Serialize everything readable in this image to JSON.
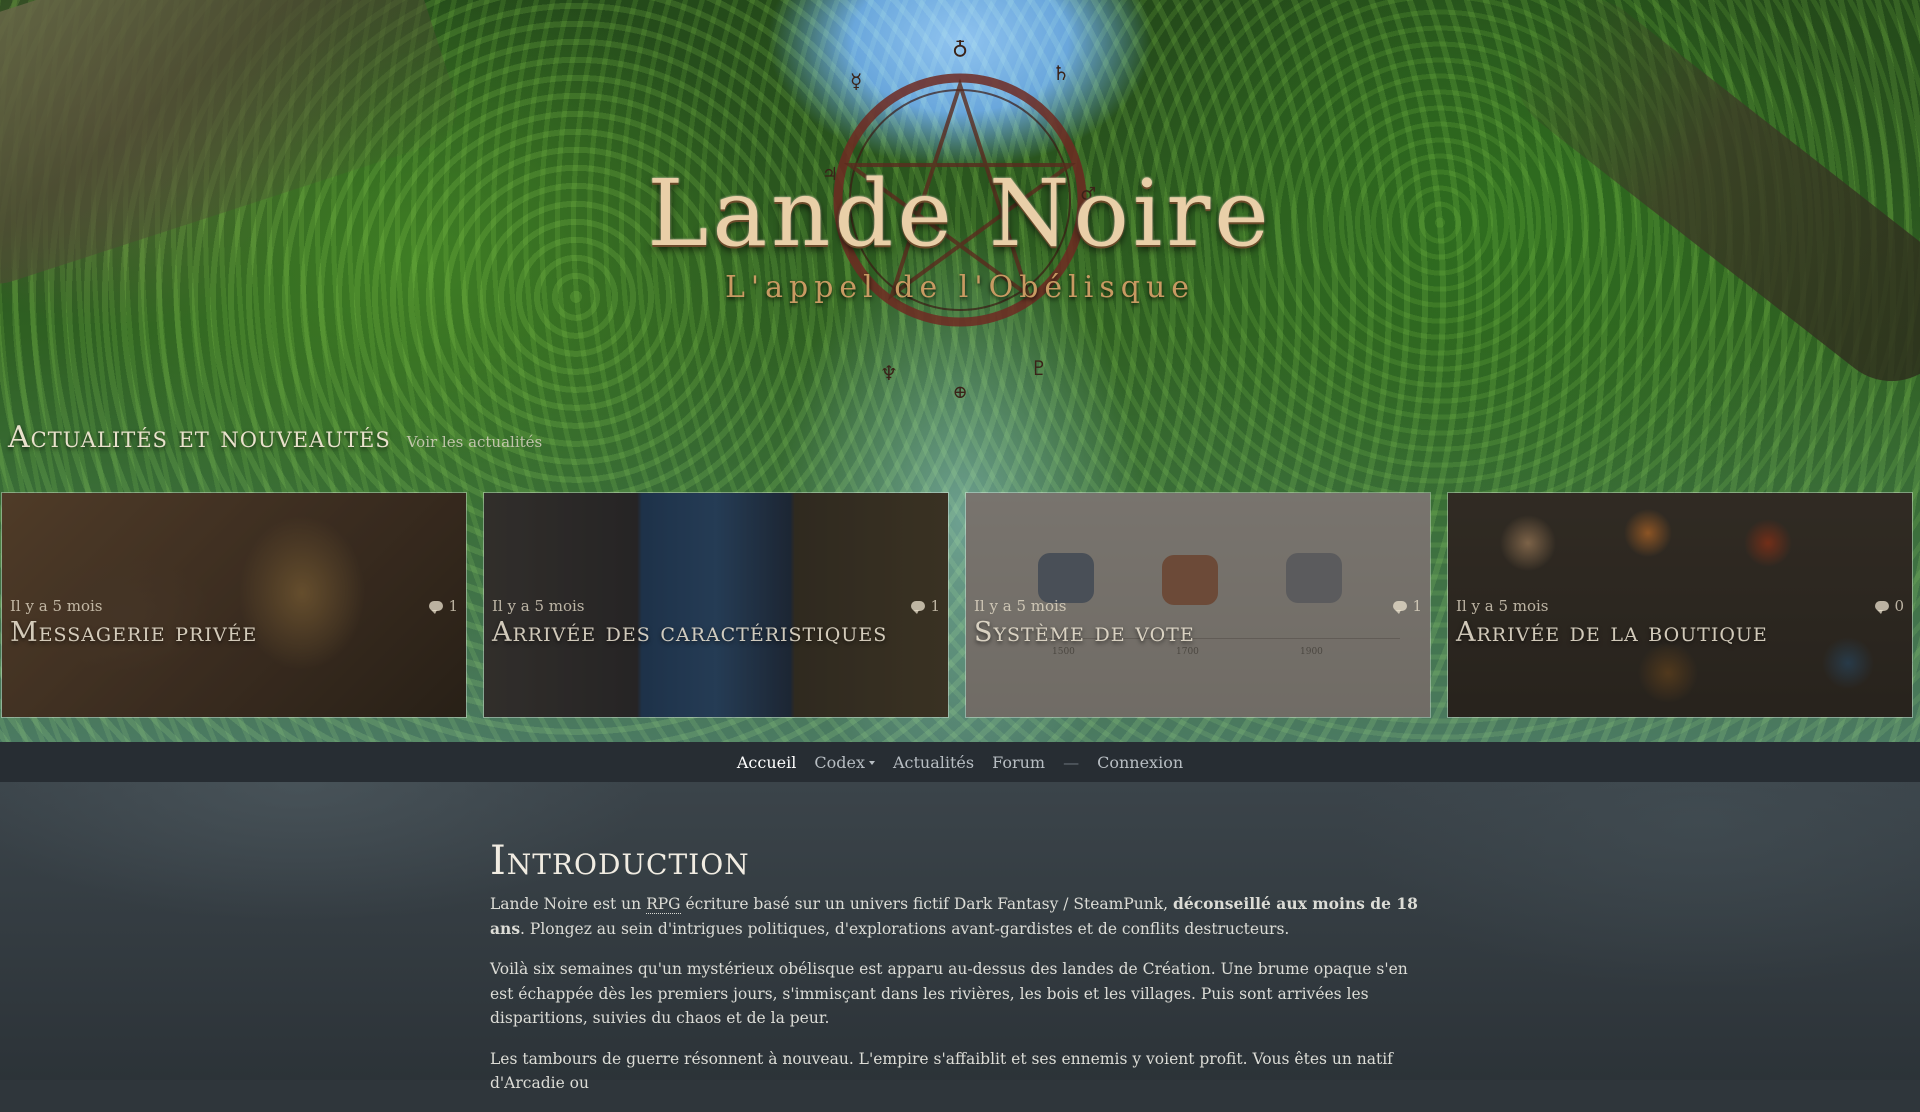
{
  "hero": {
    "logo_title": "Lande Noire",
    "logo_subtitle": "L'appel de l'Obélisque"
  },
  "news": {
    "title": "Actualités et nouveautés",
    "link": "Voir les actualités",
    "cards": [
      {
        "time": "Il y a 5 mois",
        "comments": "1",
        "title": "Messagerie privée"
      },
      {
        "time": "Il y a 5 mois",
        "comments": "1",
        "title": "Arrivée des caractéristiques"
      },
      {
        "time": "Il y a 5 mois",
        "comments": "1",
        "title": "Système de vote",
        "chart_labels": [
          "1500",
          "1700",
          "1900"
        ]
      },
      {
        "time": "Il y a 5 mois",
        "comments": "0",
        "title": "Arrivée de la boutique"
      }
    ]
  },
  "nav": {
    "items": [
      "Accueil",
      "Codex",
      "Actualités",
      "Forum"
    ],
    "separator": "—",
    "login": "Connexion"
  },
  "intro": {
    "heading": "Introduction",
    "p1_before": "Lande Noire est un ",
    "p1_abbr": "RPG",
    "p1_middle": " écriture basé sur un univers fictif Dark Fantasy / SteamPunk, ",
    "p1_bold": "déconseillé aux moins de 18 ans",
    "p1_after": ". Plongez au sein d'intrigues politiques, d'explorations avant-gardistes et de conflits destructeurs.",
    "p2": "Voilà six semaines qu'un mystérieux obélisque est apparu au-dessus des landes de Création. Une brume opaque s'en est échappée dès les premiers jours, s'immisçant dans les rivières, les bois et les villages. Puis sont arrivées les disparitions, suivies du chaos et de la peur.",
    "p3": "Les tambours de guerre résonnent à nouveau. L'empire s'affaiblit et ses ennemis y voient profit. Vous êtes un natif d'Arcadie ou"
  },
  "colors": {
    "nav_bg": "#272d33",
    "content_bg": "#2f363b",
    "logo_gold": "#e9cfa8"
  }
}
